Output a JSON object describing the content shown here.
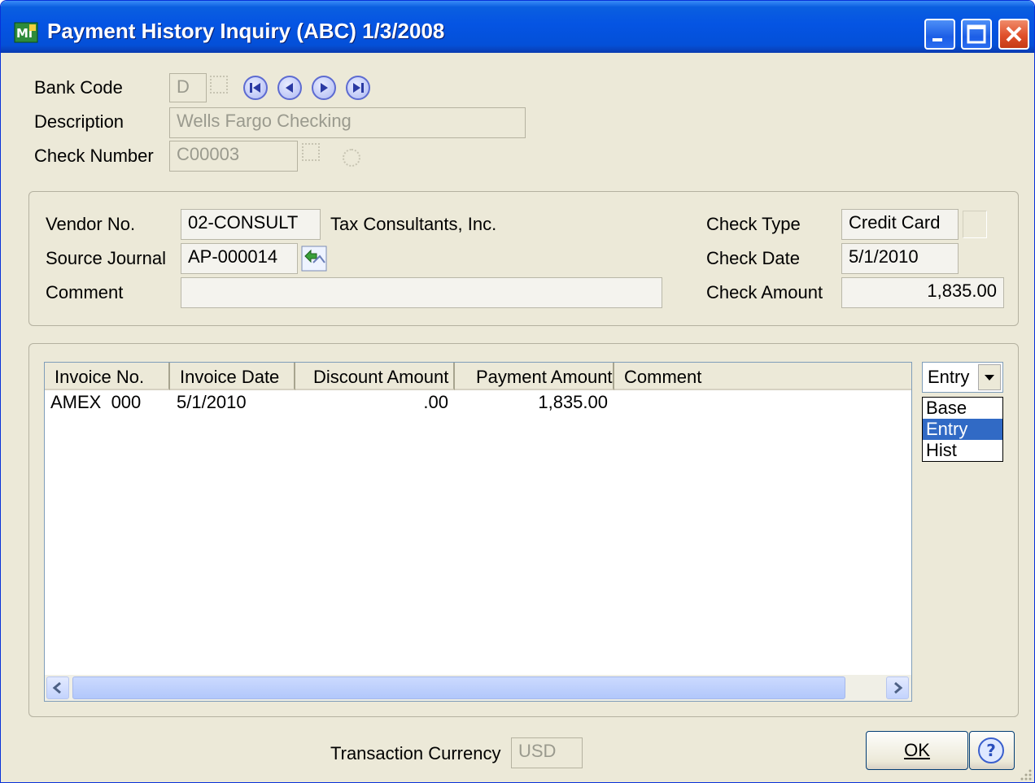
{
  "window": {
    "title": "Payment History Inquiry (ABC) 1/3/2008"
  },
  "header": {
    "bank_code_label": "Bank Code",
    "bank_code_value": "D",
    "description_label": "Description",
    "description_value": "Wells Fargo Checking",
    "check_number_label": "Check Number",
    "check_number_value": "C00003"
  },
  "details": {
    "vendor_label": "Vendor No.",
    "vendor_value": "02-CONSULT",
    "vendor_name": "Tax Consultants, Inc.",
    "source_journal_label": "Source Journal",
    "source_journal_value": "AP-000014",
    "comment_label": "Comment",
    "comment_value": "",
    "check_type_label": "Check Type",
    "check_type_value": "Credit Card",
    "check_date_label": "Check Date",
    "check_date_value": "5/1/2010",
    "check_amount_label": "Check Amount",
    "check_amount_value": "1,835.00"
  },
  "grid": {
    "columns": [
      "Invoice No.",
      "Invoice Date",
      "Discount Amount",
      "Payment Amount",
      "Comment"
    ],
    "rows": [
      {
        "invoice_no": "AMEX  000",
        "invoice_date": "5/1/2010",
        "discount": ".00",
        "payment": "1,835.00",
        "comment": ""
      }
    ]
  },
  "view_select": {
    "selected": "Entry",
    "options": [
      "Base",
      "Entry",
      "Hist"
    ]
  },
  "footer": {
    "currency_label": "Transaction Currency",
    "currency_value": "USD",
    "ok_label": "OK"
  }
}
